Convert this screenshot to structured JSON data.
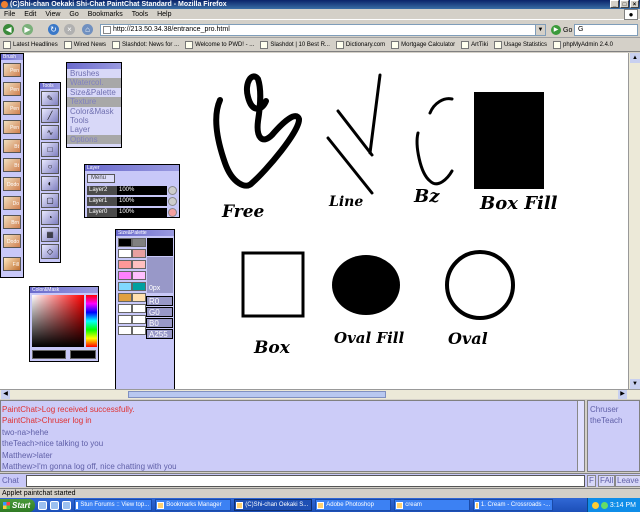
{
  "window": {
    "title": "(C)Shi-chan Oekaki Shi-Chat PaintChat Standard - Mozilla Firefox",
    "controls": {
      "minimize": "_",
      "maximize": "□",
      "close": "×"
    }
  },
  "menu": {
    "items": [
      "File",
      "Edit",
      "View",
      "Go",
      "Bookmarks",
      "Tools",
      "Help"
    ]
  },
  "navigation": {
    "url": "http://213.50.34.38/entrance_pro.html",
    "go_label": "Go",
    "search_value": "G",
    "buttons": {
      "back": "◀",
      "forward": "▶",
      "reload": "↻",
      "stop": "×",
      "home": "⌂"
    }
  },
  "bookmarks": {
    "items": [
      "Latest Headlines",
      "Wired News",
      "Slashdot: News for ...",
      "Welcome to PWD! - ...",
      "Slashdot | 10 Best R...",
      "Dictionary.com",
      "Mortgage Calculator",
      "ArtTiki",
      "Usage Statistics",
      "phpMyAdmin 2.4.0"
    ]
  },
  "paint": {
    "brush_panel_title": "Brush",
    "brush_tools": [
      "Pen",
      "Pen",
      "Pen",
      "Pen",
      "Bt",
      "Bt",
      "Dodo",
      "Do",
      "Brn",
      "Dodo",
      "Fill"
    ],
    "tool_panel_title": "Tools",
    "tool_buttons": [
      "✎",
      "╱",
      "∿",
      "□",
      "○",
      "◐",
      "▢",
      "◔",
      "▦",
      "◇"
    ],
    "menu_items": [
      "Brushes",
      "Watercol.",
      "Size&Palette",
      "Texture",
      "Color&Mask",
      "Tools",
      "Layer",
      "Options"
    ],
    "menu_highlighted": [
      1,
      3,
      7
    ],
    "layer_panel": {
      "title": "Layer",
      "menu_label": "Menu",
      "layers": [
        {
          "name": "Layer2",
          "opacity": "100%"
        },
        {
          "name": "Layer1",
          "opacity": "100%"
        },
        {
          "name": "Layer0",
          "opacity": "100%"
        }
      ]
    },
    "size_panel": {
      "title": "Size&Palette",
      "size_label": "0px",
      "rgba": [
        "R0",
        "G0",
        "B0",
        "A255"
      ],
      "swatches": [
        "#000000",
        "#808080",
        "#ffffff",
        "#e8a0a0",
        "#ff9898",
        "#ffc0c0",
        "#ff80ff",
        "#ffc0ff",
        "#80d8ff",
        "#00a0a0",
        "#e0a040",
        "#ffe0b0",
        "#ffffff",
        "#ffffff",
        "#ffffff",
        "#ffffff",
        "#ffffff",
        "#ffffff"
      ]
    },
    "color_panel": {
      "title": "Color&Mask"
    },
    "canvas_labels": {
      "free": "Free",
      "line": "Line",
      "bz": "Bz",
      "boxfill": "Box Fill",
      "box": "Box",
      "ovalfill": "Oval Fill",
      "oval": "Oval"
    }
  },
  "chat": {
    "messages": [
      {
        "text": "PaintChat>Log received successfully.",
        "color": "#e03030"
      },
      {
        "text": "PaintChat>Chruser log in",
        "color": "#e03030"
      },
      {
        "text": "two-na>hehe",
        "color": "#6060a8"
      },
      {
        "text": "theTeach>nice talking to you",
        "color": "#6060a8"
      },
      {
        "text": "Matthew>later",
        "color": "#6060a8"
      },
      {
        "text": "Matthew>I'm gonna log off, nice chatting with you",
        "color": "#6060a8"
      }
    ],
    "users": [
      "Chruser",
      "theTeach"
    ],
    "input_label": "Chat",
    "buttons": [
      "F",
      "FAll",
      "Leave"
    ]
  },
  "status": {
    "text": "Applet paintchat started"
  },
  "taskbar": {
    "start_label": "Start",
    "tasks": [
      "Stun Forums :: View top...",
      "Bookmarks Manager",
      "(C)Shi-chan Oekaki S...",
      "Adobe Photoshop",
      "cream",
      "1. Cream - Crossroads -..."
    ],
    "active_task": 2,
    "clock": "3:14 PM"
  }
}
